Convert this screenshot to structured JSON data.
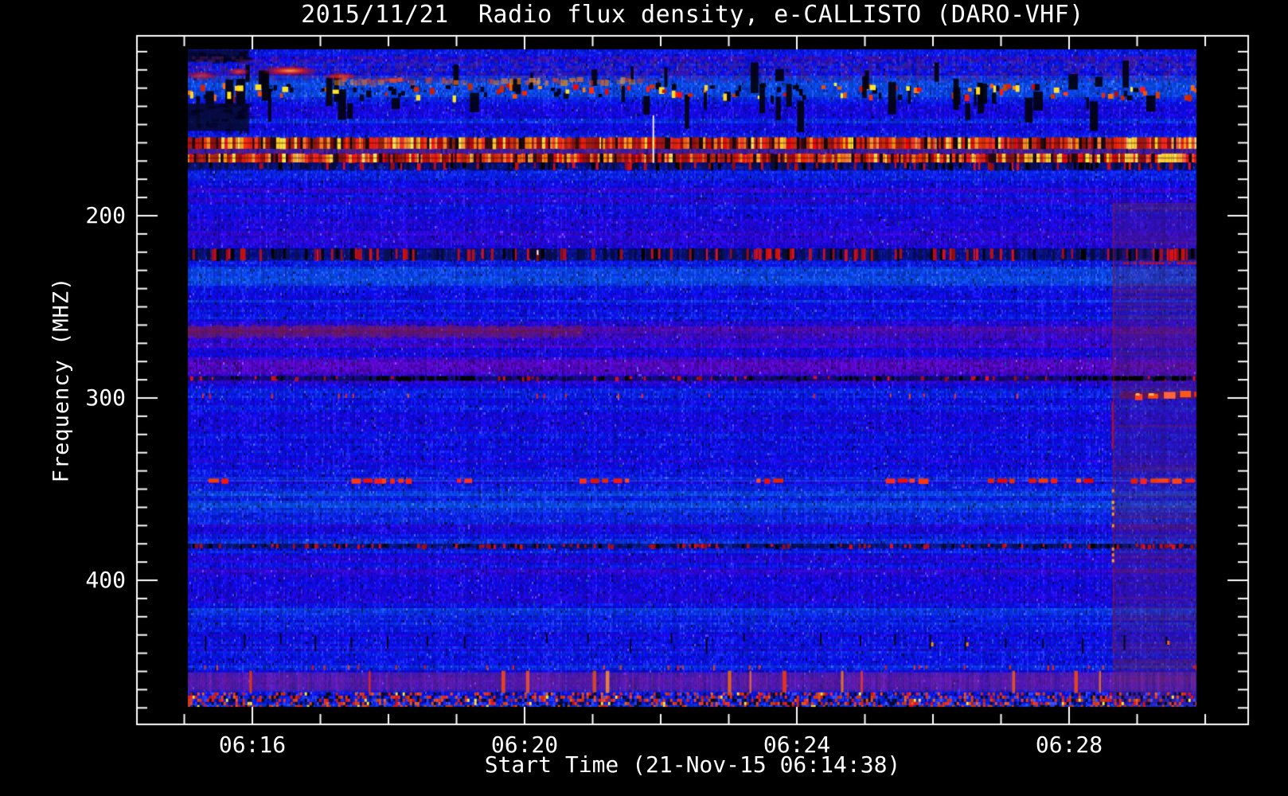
{
  "window": {
    "background": "#000000"
  },
  "chart_data": {
    "type": "heatmap",
    "title": "2015/11/21  Radio flux density, e-CALLISTO (DARO-VHF)",
    "xlabel": "Start Time (21-Nov-15 06:14:38)",
    "ylabel": "Frequency (MHZ)",
    "x_unit": "UT, minutes after 06:00",
    "y_unit": "MHz",
    "x_range": [
      15.05,
      29.87
    ],
    "y_range": [
      109,
      469.4
    ],
    "x_ticks": [
      {
        "value": 16,
        "label": "06:16"
      },
      {
        "value": 20,
        "label": "06:20"
      },
      {
        "value": 24,
        "label": "06:24"
      },
      {
        "value": 28,
        "label": "06:28"
      }
    ],
    "y_ticks": [
      {
        "value": 200,
        "label": "200"
      },
      {
        "value": 300,
        "label": "300"
      },
      {
        "value": 400,
        "label": "400"
      }
    ],
    "axes": {
      "x_minor_start": 15,
      "x_minor_end": 30,
      "x_minor_step": 1,
      "y_minor_start": 110,
      "y_minor_end": 470,
      "y_minor_step": 10,
      "grid": false,
      "frame_color": "#ffffff"
    },
    "colormap": {
      "low": "#2020cc",
      "mid": "#3535ff",
      "high": "#ff3000",
      "peak": "#ffd000",
      "gap": "#000000"
    },
    "features": [
      {
        "type": "band_tint",
        "label": "reddish instrumental band at right edge",
        "t": [
          28.64,
          29.87
        ],
        "f": [
          193,
          469.4
        ]
      },
      {
        "type": "dark_block",
        "label": "dark patch top-left",
        "t": [
          15.05,
          15.95
        ],
        "f": [
          109,
          115.5
        ]
      },
      {
        "type": "chaos_band",
        "label": "broadband noisy band with dropouts",
        "t": [
          15.05,
          29.87
        ],
        "f": [
          109,
          141
        ],
        "speckle_f": [
          127,
          136
        ],
        "black_blocks": 52,
        "yellow_dots": 16
      },
      {
        "type": "emission_arcs",
        "label": "bright red emission blobs",
        "arcs": [
          {
            "t": 15.25,
            "f": 123.0,
            "dt": 0.5,
            "df": 5.0,
            "i": 0.75
          },
          {
            "t": 15.8,
            "f": 121.0,
            "dt": 0.35,
            "df": 4.5,
            "i": 0.85
          },
          {
            "t": 16.55,
            "f": 120.5,
            "dt": 0.9,
            "df": 6.0,
            "i": 1.0
          },
          {
            "t": 17.3,
            "f": 123.5,
            "dt": 0.55,
            "df": 4.0,
            "i": 0.9
          },
          {
            "t": 18.05,
            "f": 125.5,
            "dt": 0.7,
            "df": 3.5,
            "i": 0.7
          }
        ]
      },
      {
        "type": "glow_row",
        "label": "orange glow trail",
        "t": [
          17.2,
          21.7
        ],
        "f": [
          124,
          128.5
        ]
      },
      {
        "type": "dark_block",
        "label": "dark quiet patch",
        "t": [
          15.05,
          15.95
        ],
        "f": [
          138.5,
          153.5
        ]
      },
      {
        "type": "rfi_stripe",
        "label": "strong RFI carrier stripe",
        "t": [
          15.05,
          29.87
        ],
        "f": [
          157,
          163.3
        ],
        "bright_t": [
          28.8,
          29.87
        ]
      },
      {
        "type": "purple_gap",
        "label": "gap between carriers",
        "t": [
          15.05,
          29.87
        ],
        "f": [
          163.3,
          165.9
        ]
      },
      {
        "type": "rfi_stripe",
        "label": "strong RFI carrier stripe",
        "t": [
          15.05,
          29.87
        ],
        "f": [
          165.9,
          170.8
        ],
        "bright_t": [
          28.8,
          29.87
        ]
      },
      {
        "type": "speckle_band",
        "label": "dark speckled band",
        "t": [
          15.05,
          29.87
        ],
        "f": [
          170.8,
          174.8
        ],
        "red": 0.12,
        "red_boost_t": [
          28.8,
          29.87
        ]
      },
      {
        "type": "v_streak",
        "label": "thin white vertical flash",
        "t": 21.88,
        "f": [
          145,
          171
        ]
      },
      {
        "type": "speckle_band",
        "label": "dark speckled line ~220 MHz",
        "t": [
          15.05,
          29.87
        ],
        "f": [
          218,
          224.5
        ],
        "red": 0.18,
        "white_dot": {
          "t": 20.18
        }
      },
      {
        "type": "thin_red_line",
        "label": "thin red line in right band",
        "t": [
          28.8,
          29.87
        ],
        "f": [
          225.5,
          227.2
        ]
      },
      {
        "type": "maroon_band",
        "label": "maroon band ~263 MHz, strongest at left",
        "t": [
          15.05,
          29.87
        ],
        "f": [
          260,
          266.5
        ],
        "strong_t": [
          15.05,
          20.85
        ]
      },
      {
        "type": "speckle_band",
        "label": "faint speckled line ~289 MHz",
        "t": [
          15.05,
          29.87
        ],
        "f": [
          288,
          290.5
        ],
        "red": 0.1,
        "black_t": [
          [
            17.9,
            19.25
          ],
          [
            28.0,
            29.8
          ]
        ]
      },
      {
        "type": "sparse_red_row",
        "label": "sparse red ticks ~298 MHz",
        "t": [
          15.05,
          29.87
        ],
        "f": 298.5,
        "density": 0.05
      },
      {
        "type": "red_dash_line",
        "label": "bright red dashed burst at 300 MHz right edge",
        "t": [
          28.75,
          29.86
        ],
        "f": [
          296,
          300.5
        ]
      },
      {
        "type": "dash_line",
        "label": "intermittent red dashes ~345 MHz",
        "f": 345.5,
        "clusters_t": [
          15.45,
          17.55,
          18.0,
          19.1,
          20.9,
          21.4,
          23.5,
          25.4,
          26.9,
          27.5,
          28.2,
          29.0,
          29.4
        ]
      },
      {
        "type": "speckle_band",
        "label": "speckled line ~381 MHz",
        "t": [
          15.05,
          29.87
        ],
        "f": [
          380,
          382.5
        ],
        "red": 0.22
      },
      {
        "type": "tick_row",
        "label": "periodic black tick marks ~433 MHz",
        "t": [
          15.3,
          29.7
        ],
        "f": [
          428.5,
          437.5
        ],
        "step_min": 0.57
      },
      {
        "type": "sparse_red_row",
        "label": "sparse red ticks ~447 MHz",
        "t": [
          15.05,
          29.87
        ],
        "f": 447.5,
        "density": 0.07
      },
      {
        "type": "purple_band",
        "label": "purple band near bottom",
        "t": [
          15.05,
          29.87
        ],
        "f": [
          450.5,
          461
        ],
        "red_streaks": 14
      },
      {
        "type": "speckle_rows",
        "label": "dense red/black speckle rows at bottom",
        "t": [
          15.05,
          29.87
        ],
        "f": [
          461.5,
          468.8
        ]
      },
      {
        "type": "v_line",
        "label": "maroon vertical boundary of right band",
        "t": 28.64,
        "f": [
          193,
          440
        ],
        "dots_f": [
          350,
          390
        ],
        "red_f": [
          302,
          328
        ]
      }
    ]
  }
}
